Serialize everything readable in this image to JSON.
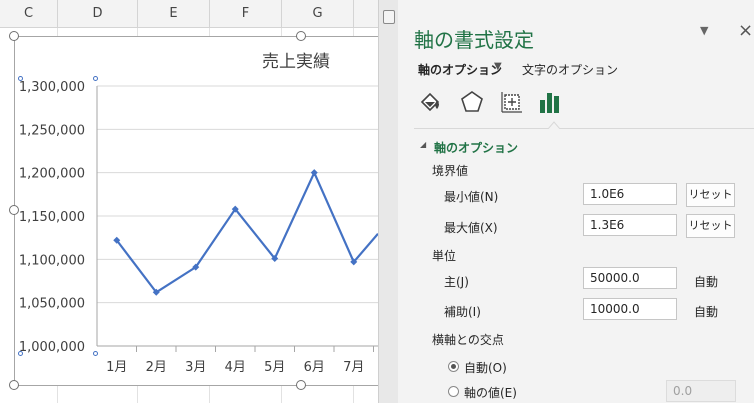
{
  "sheet": {
    "columns": [
      "C",
      "D",
      "E",
      "F",
      "G"
    ]
  },
  "chart_data": {
    "type": "line",
    "title": "売上実績",
    "categories": [
      "1月",
      "2月",
      "3月",
      "4月",
      "5月",
      "6月",
      "7月"
    ],
    "series": [
      {
        "values": [
          1122000,
          1062000,
          1091000,
          1158000,
          1101000,
          1200000,
          1097000
        ]
      }
    ],
    "y_tick_labels": [
      "1,300,000",
      "1,250,000",
      "1,200,000",
      "1,150,000",
      "1,100,000",
      "1,050,000",
      "1,000,000"
    ],
    "ylim": [
      1000000,
      1300000
    ],
    "y_major_unit": 50000,
    "grid": true,
    "line_color": "#4472c4"
  },
  "pane": {
    "title": "軸の書式設定",
    "menu_glyph": "▼",
    "close_glyph": "×",
    "tabs": {
      "axis_options": "軸のオプション",
      "axis_caret": "▼",
      "text_options": "文字のオプション"
    },
    "icons": [
      "fill-line-icon",
      "effects-pentagon-icon",
      "size-properties-icon",
      "axis-options-bars-icon"
    ],
    "section_title": "軸のオプション",
    "bounds_label": "境界値",
    "min_label": "最小値(N)",
    "min_value": "1.0E6",
    "max_label": "最大値(X)",
    "max_value": "1.3E6",
    "reset_label": "リセット",
    "units_label": "単位",
    "major_label": "主(J)",
    "major_value": "50000.0",
    "minor_label": "補助(I)",
    "minor_value": "10000.0",
    "auto_label": "自動",
    "cross_label": "横軸との交点",
    "auto_radio_label": "自動(O)",
    "axis_value_label": "軸の値(E)",
    "axis_value": "0.0",
    "accent_color": "#217346"
  }
}
